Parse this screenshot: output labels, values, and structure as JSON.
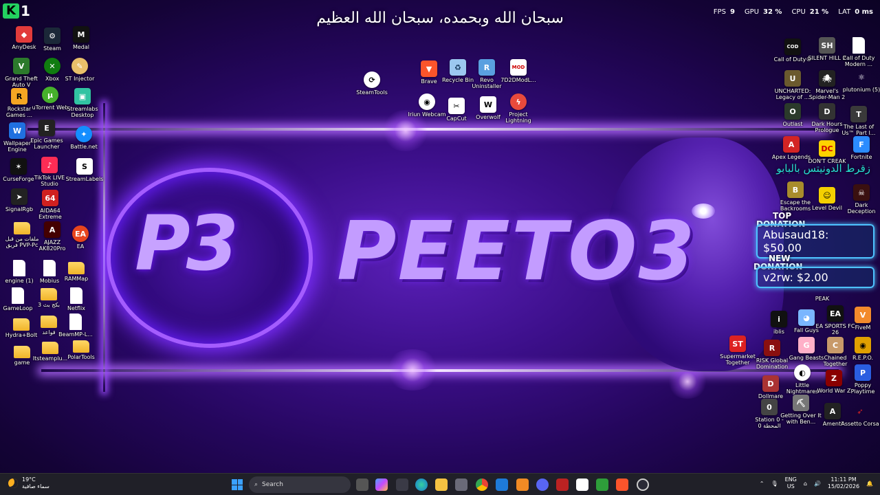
{
  "overlay": {
    "badge": "K",
    "badge_num": "1",
    "fps_label": "FPS",
    "fps": "9",
    "gpu_label": "GPU",
    "gpu": "32 %",
    "cpu_label": "CPU",
    "cpu": "21 %",
    "lat_label": "LAT",
    "lat": "0 ms"
  },
  "banner": {
    "arabic_text": "سبحان الله وبحمده، سبحان الله العظيم",
    "logo": "P3",
    "name": "PEETO3"
  },
  "icons": {
    "anydesk": "AnyDesk",
    "steam": "Steam",
    "medal": "Medal",
    "gta": "Grand Theft Auto V",
    "xbox": "Xbox",
    "stinjector": "ST Injector",
    "rockstar": "Rockstar Games ...",
    "utorrent": "uTorrent Web",
    "streamlabs": "Streamlabs Desktop",
    "wallpaper": "Wallpaper Engine",
    "epic": "Epic Games Launcher",
    "battlenet": "Battle.net",
    "curseforge": "CurseForge",
    "tiktok": "TikTok LIVE Studio",
    "streamlabels": "StreamLabels",
    "signalrgb": "SignalRgb",
    "aida": "AIDA64 Extreme",
    "pvp": "ملفات من قبل فريق PVP-Pc",
    "ajazz": "AJAZZ AK820Pro",
    "ea": "EA",
    "engine1": "engine (1)",
    "mobius": "Mobius",
    "rammap": "RAMMap",
    "gameloop": "GameLoop",
    "ar3": "بكج بث 3",
    "netflix": "Netflix",
    "hydra": "Hydra+Bolt",
    "ar_qawaid": "قواعد",
    "beammp": "BeamMP-L...",
    "game": "game",
    "itsteam": "Itsteamplu...",
    "polartools": "PolarTools",
    "steamtools": "SteamTools",
    "brave": "Brave",
    "recycle": "Recycle Bin",
    "revo": "Revo Uninstaller",
    "moddl": "7D2DModL...",
    "iriun": "Iriun Webcam",
    "capcut": "CapCut",
    "overwolf": "Overwolf",
    "lightning": "Project Lightning",
    "cod": "Call of Duty®",
    "silenthill": "SILENT HILL 2",
    "codmodern": "Call of Duty Modern ...",
    "uncharted": "UNCHARTED: Legacy of ...",
    "spiderman": "Marvel's Spider-Man 2",
    "plutonium": "plutonium (5)",
    "outlast": "Outlast",
    "darkhours": "Dark Hours Prologue",
    "lastofus": "The Last of Us™ Part I...",
    "apex": "Apex Legends",
    "dontcreak": "DON'T CREAK",
    "fortnite": "Fortnite",
    "backrooms": "Escape the Backrooms",
    "leveldevil": "Level Devil",
    "darkdeception": "Dark Deception",
    "peak": "PEAK",
    "iblis": "iblis",
    "fallguys": "Fall Guys",
    "easports": "EA SPORTS FC 26",
    "fivem": "FiveM",
    "supermarket": "Supermarket Together",
    "risk": "RISK Global Domination",
    "gangbeasts": "Gang Beasts",
    "chained": "Chained Together",
    "repo": "R.E.P.O.",
    "littlenightmares": "Little Nightmares",
    "worldwarz": "World War Z",
    "poppy": "Poppy Playtime",
    "dollmare": "Dollmare",
    "station0": "Station 0 - المحطة 0",
    "gettingover": "Getting Over It with Ben...",
    "amenti": "Amenti",
    "assetto": "Assetto Corsa"
  },
  "stream_overlay": {
    "arabic_green": "زقرط الدونيتس بالبابو",
    "top_label_1": "TOP",
    "top_label_2": "DONATION",
    "top_donation": "Abusaud18: $50.00",
    "new_label_1": "NEW",
    "new_label_2": "DONATION",
    "new_donation": "v2rw: $2.00"
  },
  "taskbar": {
    "temp": "19°C",
    "weather_desc": "سماء صافية",
    "search": "Search",
    "lang": "ENG",
    "region": "US",
    "time": "11:11 PM",
    "date": "15/02/2026"
  }
}
